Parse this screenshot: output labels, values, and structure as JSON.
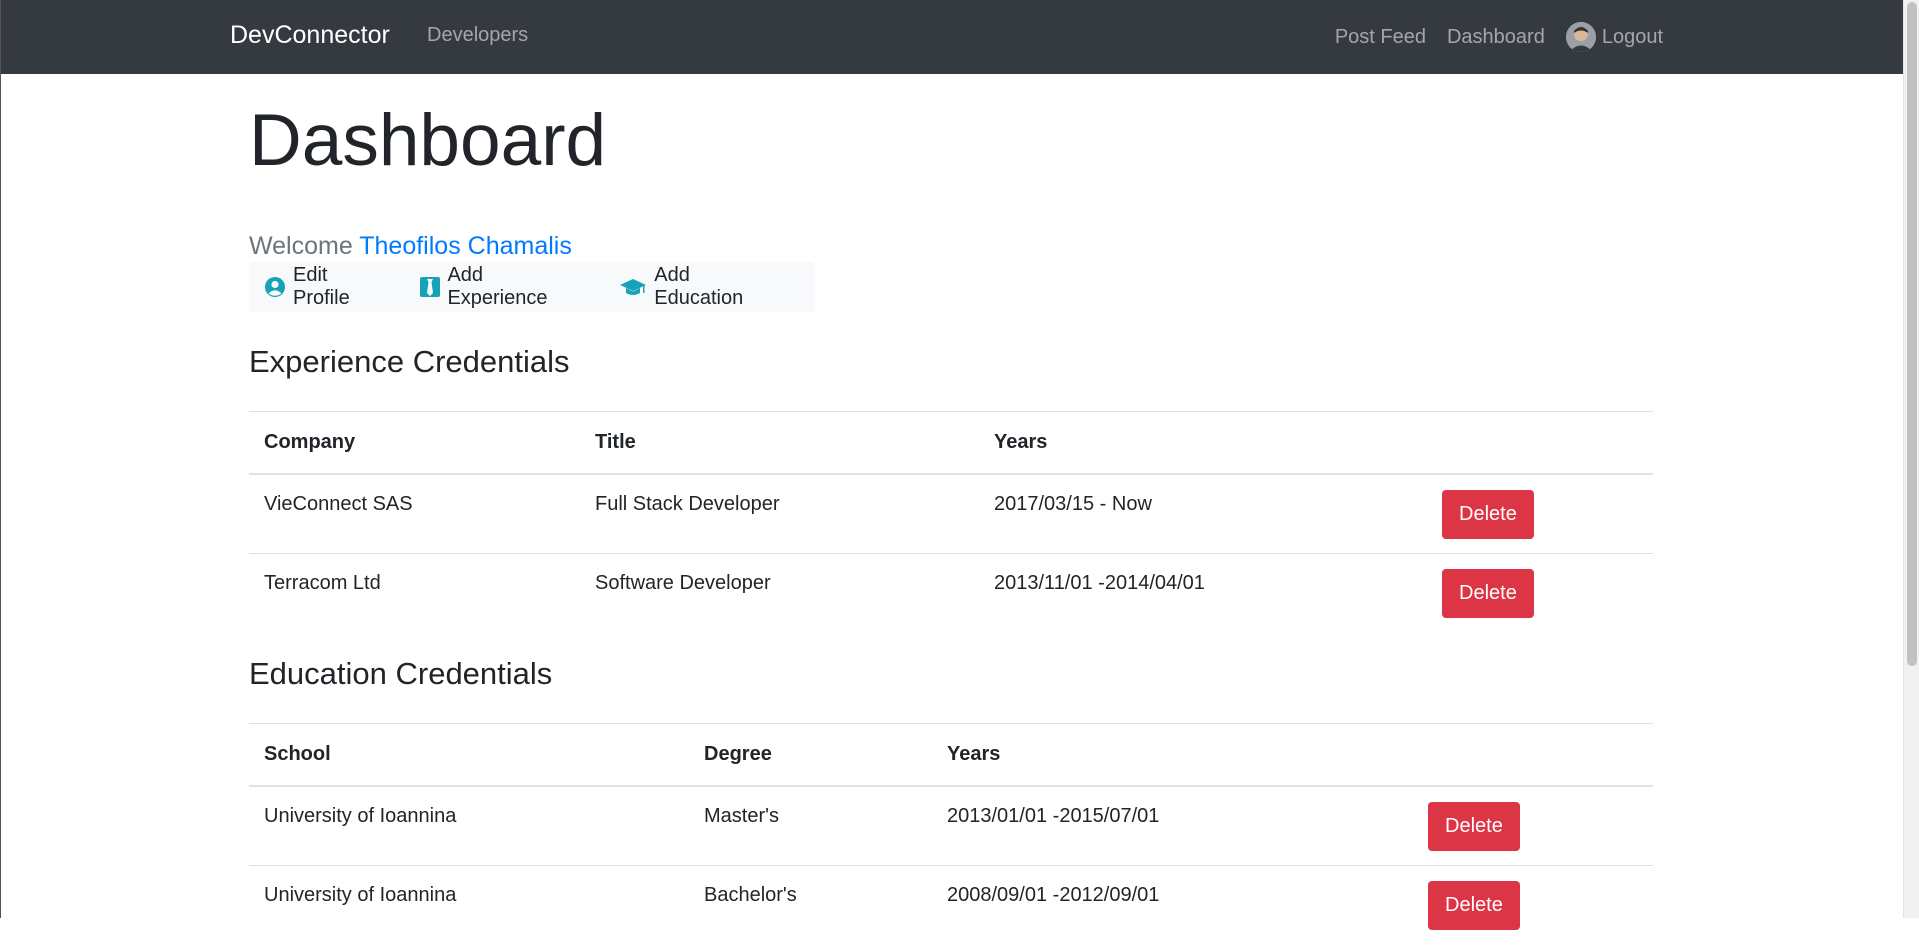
{
  "navbar": {
    "brand": "DevConnector",
    "developers": "Developers",
    "post_feed": "Post Feed",
    "dashboard": "Dashboard",
    "logout": "Logout",
    "bg_color": "#343a40"
  },
  "main": {
    "title": "Dashboard",
    "welcome_prefix": "Welcome",
    "user_name": "Theofilos Chamalis",
    "actions": {
      "edit_profile": "Edit Profile",
      "add_experience": "Add Experience",
      "add_education": "Add Education",
      "icon_color": "#17a2b8"
    },
    "experience": {
      "heading": "Experience Credentials",
      "headers": [
        "Company",
        "Title",
        "Years"
      ],
      "rows": [
        {
          "company": "VieConnect SAS",
          "title": "Full Stack Developer",
          "years": "2017/03/15 - Now",
          "delete": "Delete"
        },
        {
          "company": "Terracom Ltd",
          "title": "Software Developer",
          "years": "2013/11/01 -2014/04/01",
          "delete": "Delete"
        }
      ]
    },
    "education": {
      "heading": "Education Credentials",
      "headers": [
        "School",
        "Degree",
        "Years"
      ],
      "rows": [
        {
          "school": "University of Ioannina",
          "degree": "Master's",
          "years": "2013/01/01 -2015/07/01",
          "delete": "Delete"
        },
        {
          "school": "University of Ioannina",
          "degree": "Bachelor's",
          "years": "2008/09/01 -2012/09/01",
          "delete": "Delete"
        }
      ]
    },
    "danger_color": "#dc3545",
    "link_color": "#007bff"
  }
}
